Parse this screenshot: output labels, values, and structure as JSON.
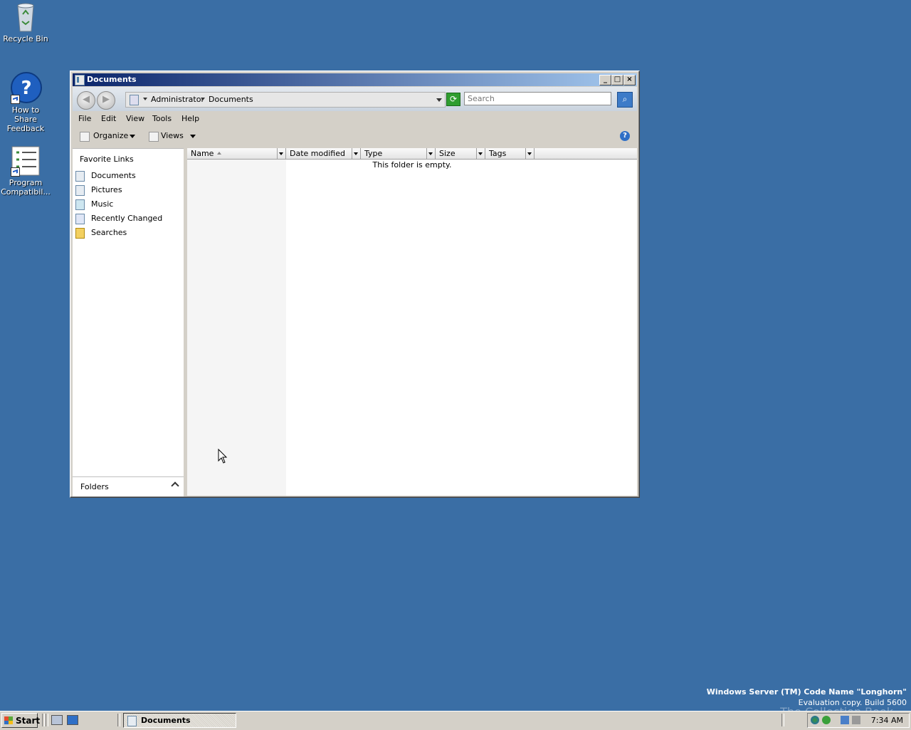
{
  "desktop": {
    "icons": [
      {
        "label": "Recycle Bin"
      },
      {
        "label": "How to Share Feedback"
      },
      {
        "label": "Program Compatibil..."
      }
    ],
    "watermark": {
      "line1": "Windows Server (TM) Code Name \"Longhorn\"",
      "line2": "Evaluation copy. Build 5600",
      "overlay": "The Collection Book"
    }
  },
  "window": {
    "title": "Documents",
    "controls": {
      "minimize": "_",
      "maximize": "□",
      "close": "×"
    },
    "nav": {
      "back": "◀",
      "forward": "▶"
    },
    "address": {
      "crumbs": [
        "Administrator",
        "Documents"
      ]
    },
    "search": {
      "placeholder": "Search"
    },
    "menu": [
      "File",
      "Edit",
      "View",
      "Tools",
      "Help"
    ],
    "toolbar": {
      "organize": "Organize",
      "views": "Views",
      "help": "?"
    },
    "nav_pane": {
      "header": "Favorite Links",
      "links": [
        {
          "label": "Documents",
          "icon": "documents-icon",
          "color": "#4a7fa8"
        },
        {
          "label": "Pictures",
          "icon": "pictures-icon",
          "color": "#4a7fa8"
        },
        {
          "label": "Music",
          "icon": "music-icon",
          "color": "#2f8fb0"
        },
        {
          "label": "Recently Changed",
          "icon": "recent-icon",
          "color": "#6a8ac8"
        },
        {
          "label": "Searches",
          "icon": "searches-icon",
          "color": "#e0b020"
        }
      ],
      "folders_label": "Folders"
    },
    "columns": [
      "Name",
      "Date modified",
      "Type",
      "Size",
      "Tags"
    ],
    "empty_message": "This folder is empty."
  },
  "taskbar": {
    "start_label": "Start",
    "tasks": [
      {
        "label": "Documents"
      }
    ],
    "clock": "7:34 AM"
  },
  "colors": {
    "desktop": "#3a6ea5",
    "title_start": "#0a246a",
    "title_end": "#a6caf0"
  }
}
